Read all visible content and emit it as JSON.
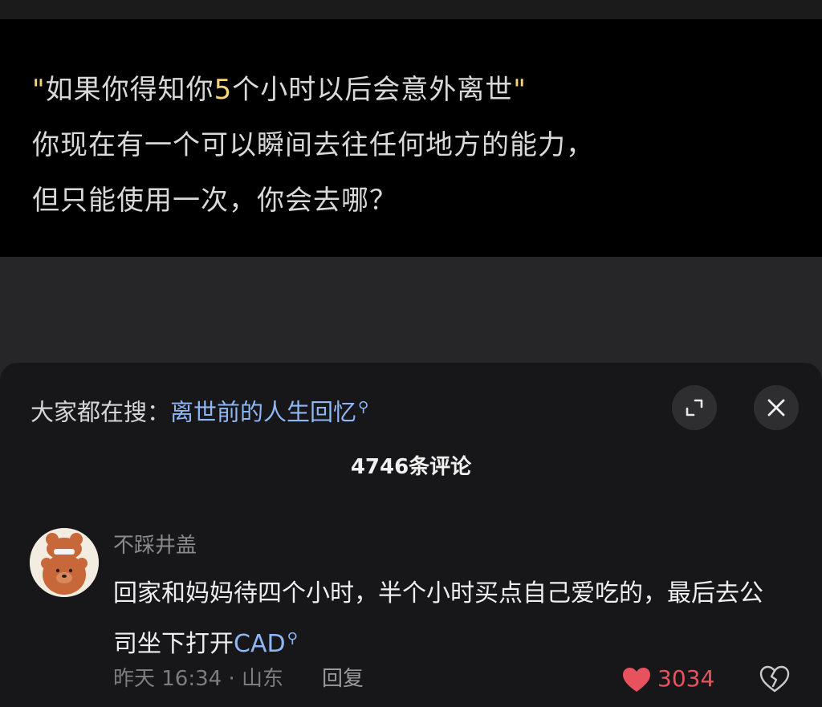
{
  "video": {
    "caption_line1_open_quote": "\"",
    "caption_line1_a": "如果你得知你",
    "caption_line1_number": "5",
    "caption_line1_b": "个小时以后会意外离世",
    "caption_line1_close_quote": "\"",
    "caption_line2": "你现在有一个可以瞬间去往任何地方的能力，",
    "caption_line3": "但只能使用一次，你会去哪？"
  },
  "search_bar": {
    "prefix": "大家都在搜：",
    "term": "离世前的人生回忆",
    "icon": "search-icon"
  },
  "header_buttons": {
    "expand_icon": "expand-icon",
    "close_icon": "close-icon"
  },
  "comments_header": {
    "count_label": "4746条评论"
  },
  "comment": {
    "username": "不踩井盖",
    "avatar_icon": "bear-avatar",
    "text_before_link": "回家和妈妈待四个小时，半个小时买点自己爱吃的，最后去公司坐下打开",
    "link_text": "CAD",
    "link_icon": "search-icon",
    "time_location": "昨天 16:34 · 山东",
    "reply_label": "回复",
    "like_count": "3034",
    "liked": true,
    "like_color": "#e8525e",
    "dislike_icon": "broken-heart-icon"
  },
  "colors": {
    "highlight": "#f4d77a",
    "link": "#8fb6f5",
    "panel_bg": "#171719"
  }
}
